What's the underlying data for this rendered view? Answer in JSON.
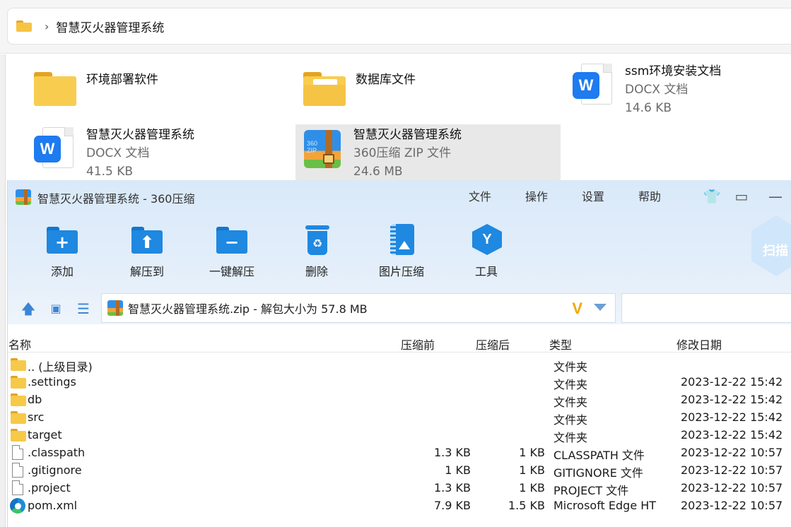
{
  "explorer": {
    "breadcrumb": "智慧灭火器管理系统",
    "items": [
      {
        "name": "环境部署软件",
        "type": "",
        "size": ""
      },
      {
        "name": "数据库文件",
        "type": "",
        "size": ""
      },
      {
        "name": "ssm环境安装文档",
        "type": "DOCX 文档",
        "size": "14.6 KB"
      },
      {
        "name": "智慧灭火器管理系统",
        "type": "DOCX 文档",
        "size": "41.5 KB"
      },
      {
        "name": "智慧灭火器管理系统",
        "type": "360压缩 ZIP 文件",
        "size": "24.6 MB"
      }
    ]
  },
  "zip_app": {
    "title": "智慧灭火器管理系统 - 360压缩",
    "menu": [
      "文件",
      "操作",
      "设置",
      "帮助"
    ],
    "toolbar": [
      "添加",
      "解压到",
      "一键解压",
      "删除",
      "图片压缩",
      "工具"
    ],
    "scan_label": "扫描",
    "path": "智慧灭火器管理系统.zip - 解包大小为 57.8 MB",
    "columns": [
      "名称",
      "压缩前",
      "压缩后",
      "类型",
      "修改日期"
    ],
    "rows": [
      {
        "icon": "folder",
        "name": ".. (上级目录)",
        "before": "",
        "after": "",
        "type": "文件夹",
        "date": ""
      },
      {
        "icon": "folder",
        "name": ".settings",
        "before": "",
        "after": "",
        "type": "文件夹",
        "date": "2023-12-22 15:42"
      },
      {
        "icon": "folder",
        "name": "db",
        "before": "",
        "after": "",
        "type": "文件夹",
        "date": "2023-12-22 15:42"
      },
      {
        "icon": "folder",
        "name": "src",
        "before": "",
        "after": "",
        "type": "文件夹",
        "date": "2023-12-22 15:42"
      },
      {
        "icon": "folder",
        "name": "target",
        "before": "",
        "after": "",
        "type": "文件夹",
        "date": "2023-12-22 15:42"
      },
      {
        "icon": "file",
        "name": ".classpath",
        "before": "1.3 KB",
        "after": "1 KB",
        "type": "CLASSPATH 文件",
        "date": "2023-12-22 10:57"
      },
      {
        "icon": "file",
        "name": ".gitignore",
        "before": "1 KB",
        "after": "1 KB",
        "type": "GITIGNORE 文件",
        "date": "2023-12-22 10:57"
      },
      {
        "icon": "file",
        "name": ".project",
        "before": "1.3 KB",
        "after": "1 KB",
        "type": "PROJECT 文件",
        "date": "2023-12-22 10:57"
      },
      {
        "icon": "edge",
        "name": "pom.xml",
        "before": "7.9 KB",
        "after": "1.5 KB",
        "type": "Microsoft Edge HT",
        "date": "2023-12-22 10:57"
      }
    ]
  }
}
